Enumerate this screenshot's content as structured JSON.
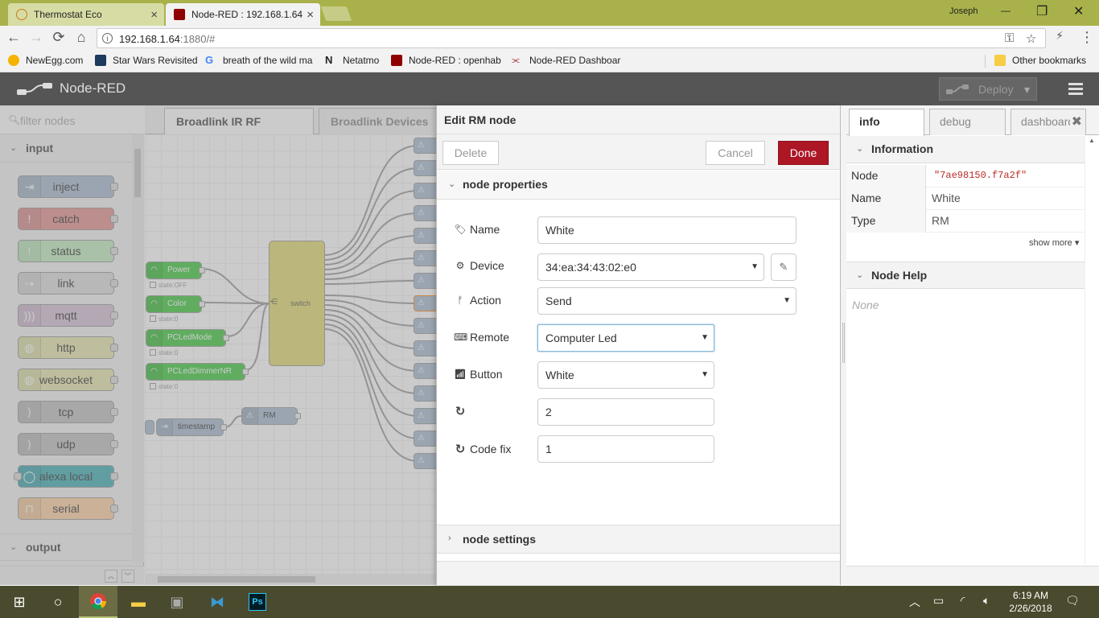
{
  "browser": {
    "tabs": [
      {
        "title": "Thermostat Eco",
        "close": "×"
      },
      {
        "title": "Node-RED : 192.168.1.64",
        "close": "×"
      }
    ],
    "profile_name": "Joseph",
    "window_controls": {
      "minimize": "—",
      "maximize": "❐",
      "close": "✕"
    },
    "nav": {
      "back": "←",
      "forward": "→",
      "reload": "⟳",
      "home": "⌂"
    },
    "url_host": "192.168.1.64",
    "url_rest": ":1880/#",
    "omnibox_icons": {
      "key": "⚿",
      "star": "☆",
      "ext": "⚡",
      "menu": "⋮"
    },
    "bookmarks": [
      {
        "label": "NewEgg.com",
        "color": "#f4b400"
      },
      {
        "label": "Star Wars Revisited",
        "color": "#1e3a5f"
      },
      {
        "label": "breath of the wild ma",
        "color": "#ffffff"
      },
      {
        "label": "Netatmo",
        "color": "#ffffff"
      },
      {
        "label": "Node-RED : openhab",
        "color": "#8f0000"
      },
      {
        "label": "Node-RED Dashboar",
        "color": "#ffffff"
      }
    ],
    "other_bookmarks": "Other bookmarks"
  },
  "nodered": {
    "title": "Node-RED",
    "deploy_label": "Deploy",
    "palette": {
      "search_placeholder": "filter nodes",
      "category_input": "input",
      "category_output": "output",
      "nodes": [
        {
          "label": "inject",
          "color": "#a6bbcf",
          "icon": "⇥"
        },
        {
          "label": "catch",
          "color": "#e49191",
          "icon": "!"
        },
        {
          "label": "status",
          "color": "#c0edc0",
          "icon": "!"
        },
        {
          "label": "link",
          "color": "#dddddd",
          "icon": "⇢"
        },
        {
          "label": "mqtt",
          "color": "#d8bfd8",
          "icon": ")))"
        },
        {
          "label": "http",
          "color": "#e7e7ae",
          "icon": "◍"
        },
        {
          "label": "websocket",
          "color": "#e7e7ae",
          "icon": "◍"
        },
        {
          "label": "tcp",
          "color": "#c0c0c0",
          "icon": "⟩"
        },
        {
          "label": "udp",
          "color": "#c0c0c0",
          "icon": "⟩"
        },
        {
          "label": "alexa local",
          "color": "#3fadb5",
          "icon": "◯"
        },
        {
          "label": "serial",
          "color": "#fdd0a2",
          "icon": "⊓"
        }
      ]
    },
    "workspace": {
      "tabs": [
        "Broadlink IR RF",
        "Broadlink Devices"
      ],
      "flow_nodes": [
        {
          "label": "Power",
          "status": "state:OFF"
        },
        {
          "label": "Color",
          "status": "state:0"
        },
        {
          "label": "PCLedMode",
          "status": "state:0"
        },
        {
          "label": "PCLedDimmerNR",
          "status": "state:0"
        }
      ],
      "switch_label": "switch",
      "timestamp_label": "timestamp",
      "rm_label": "RM"
    },
    "tray": {
      "title": "Edit RM node",
      "delete": "Delete",
      "cancel": "Cancel",
      "done": "Done",
      "section_properties": "node properties",
      "section_settings": "node settings",
      "fields": {
        "name_label": "Name",
        "name_value": "White",
        "device_label": "Device",
        "device_value": "34:ea:34:43:02:e0",
        "action_label": "Action",
        "action_value": "Send",
        "remote_label": "Remote",
        "remote_value": "Computer Led",
        "button_label": "Button",
        "button_value": "White",
        "repeat_value": "2",
        "codefix_label": "Code fix",
        "codefix_value": "1"
      }
    },
    "sidebar": {
      "tabs": [
        "info",
        "debug",
        "dashboard"
      ],
      "information": "Information",
      "rows": [
        {
          "key": "Node",
          "value": "\"7ae98150.f7a2f\""
        },
        {
          "key": "Name",
          "value": "White"
        },
        {
          "key": "Type",
          "value": "RM"
        }
      ],
      "show_more": "show more ▾",
      "node_help": "Node Help",
      "help_text": "None"
    }
  },
  "taskbar": {
    "time": "6:19 AM",
    "date": "2/26/2018"
  }
}
